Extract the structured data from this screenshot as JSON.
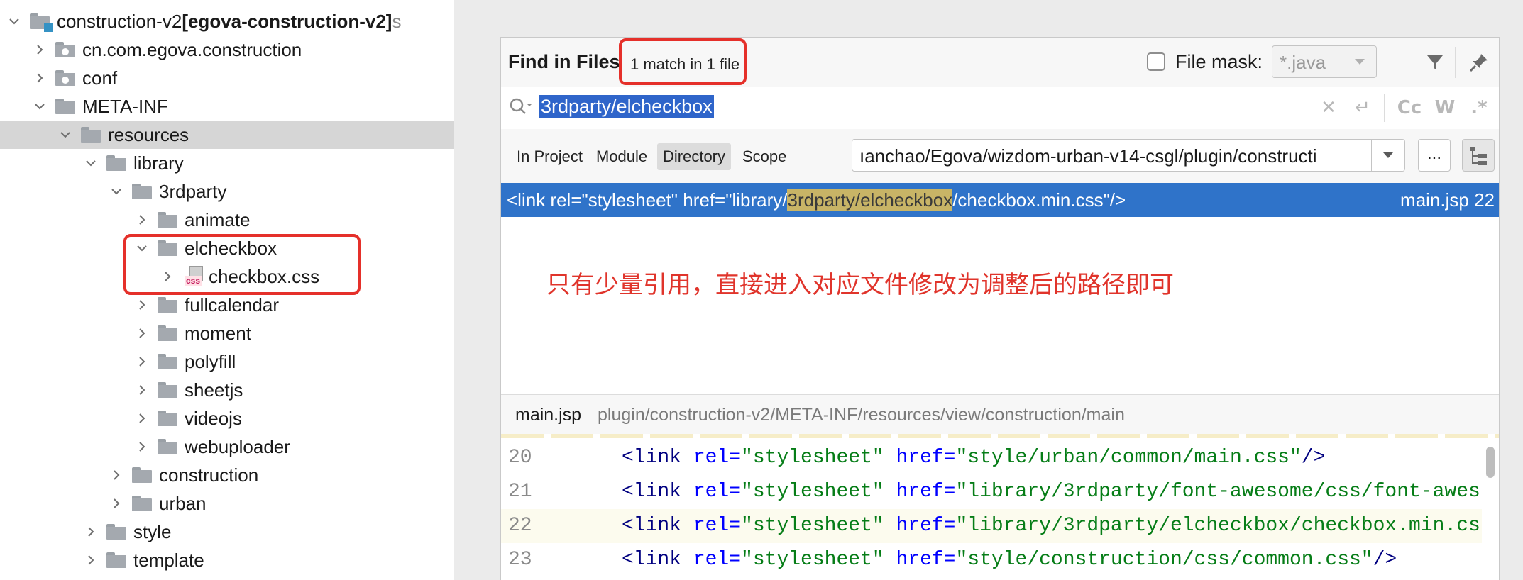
{
  "tree": {
    "items": [
      {
        "label": "construction-v2",
        "suffix": " [egova-construction-v2]",
        "trailing": " s",
        "type": "module",
        "expanded": true
      },
      {
        "label": "cn.com.egova.construction",
        "type": "package",
        "expanded": false
      },
      {
        "label": "conf",
        "type": "package",
        "expanded": false
      },
      {
        "label": "META-INF",
        "type": "folder",
        "expanded": true
      },
      {
        "label": "resources",
        "type": "folder",
        "expanded": true,
        "selected": true
      },
      {
        "label": "library",
        "type": "folder",
        "expanded": true
      },
      {
        "label": "3rdparty",
        "type": "folder",
        "expanded": true
      },
      {
        "label": "animate",
        "type": "folder",
        "expanded": false
      },
      {
        "label": "elcheckbox",
        "type": "folder",
        "expanded": true
      },
      {
        "label": "checkbox.css",
        "type": "css",
        "icon_tag": "css",
        "expanded": false
      },
      {
        "label": "fullcalendar",
        "type": "folder",
        "expanded": false
      },
      {
        "label": "moment",
        "type": "folder",
        "expanded": false
      },
      {
        "label": "polyfill",
        "type": "folder",
        "expanded": false
      },
      {
        "label": "sheetjs",
        "type": "folder",
        "expanded": false
      },
      {
        "label": "videojs",
        "type": "folder",
        "expanded": false
      },
      {
        "label": "webuploader",
        "type": "folder",
        "expanded": false
      },
      {
        "label": "construction",
        "type": "folder",
        "expanded": false
      },
      {
        "label": "urban",
        "type": "folder",
        "expanded": false
      },
      {
        "label": "style",
        "type": "folder",
        "expanded": false
      },
      {
        "label": "template",
        "type": "folder",
        "expanded": false
      }
    ]
  },
  "dialog": {
    "title": "Find in Files",
    "match_count": "1 match in 1 file",
    "file_mask_label": "File mask:",
    "file_mask_value": "*.java",
    "file_mask_checked": false,
    "search_query": "3rdparty/elcheckbox",
    "option_case": "Cc",
    "option_word": "W",
    "option_regex": ".*",
    "scopes": [
      {
        "label": "In Project",
        "active": false
      },
      {
        "label": "Module",
        "active": false
      },
      {
        "label": "Directory",
        "active": true
      },
      {
        "label": "Scope",
        "active": false
      }
    ],
    "directory_value": "ıanchao/Egova/wizdom-urban-v14-csgl/plugin/constructi",
    "browse_label": "...",
    "result": {
      "prefix": "<link rel=\"stylesheet\" href=\"library/",
      "match": "3rdparty/elcheckbox",
      "suffix": "/checkbox.min.css\"/>",
      "file": "main.jsp 22"
    },
    "annotation": "只有少量引用，直接进入对应文件修改为调整后的路径即可",
    "preview": {
      "file": "main.jsp",
      "path": "plugin/construction-v2/META-INF/resources/view/construction/main",
      "lines": [
        {
          "num": "20",
          "parts": [
            "<link",
            " rel=",
            "\"stylesheet\"",
            " href=",
            "\"style/urban/common/main.css\"",
            "/>"
          ]
        },
        {
          "num": "21",
          "parts": [
            "<link",
            " rel=",
            "\"stylesheet\"",
            " href=",
            "\"library/3rdparty/font-awesome/css/font-awes",
            ""
          ]
        },
        {
          "num": "22",
          "parts": [
            "<link",
            " rel=",
            "\"stylesheet\"",
            " href=",
            "\"library/3rdparty/elcheckbox/checkbox.min.cs",
            ""
          ]
        },
        {
          "num": "23",
          "parts": [
            "<link",
            " rel=",
            "\"stylesheet\"",
            " href=",
            "\"style/construction/css/common.css\"",
            "/>"
          ]
        }
      ]
    }
  },
  "colors": {
    "selection_blue": "#2f73c9",
    "annotation_red": "#e5302a"
  }
}
